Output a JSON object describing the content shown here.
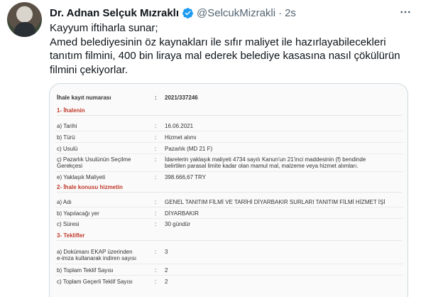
{
  "author": {
    "name": "Dr. Adnan Selçuk Mızraklı",
    "handle": "@SelcukMizrakli",
    "separator": "·",
    "time": "2s"
  },
  "tweet": {
    "lines": [
      "Kayyum iftiharla sunar;",
      "Amed belediyesinin öz kaynakları ile sıfır maliyet ile hazırlayabilecekleri",
      "tanıtım filmini, 400 bin liraya mal ederek belediye kasasına nasıl çökülürün",
      "filmini çekiyorlar."
    ]
  },
  "document": {
    "ihale_kayit": {
      "label": "İhale kayıt numarası",
      "sep": ":",
      "value": "2021/337246"
    },
    "section1": "1- İhalenin",
    "rows1": [
      {
        "label": "a) Tarihi",
        "sep": ":",
        "value": "16.06.2021"
      },
      {
        "label": "b) Türü",
        "sep": ":",
        "value": "Hizmet alımı"
      },
      {
        "label": "c) Usulü",
        "sep": ":",
        "value": "Pazarlık (MD 21 F)"
      },
      {
        "label": "ç) Pazarlık Usulünün Seçilme",
        "label2": "Gerekçesi",
        "sep": ":",
        "value": "İdarelerin yaklaşık maliyeti 4734 sayılı Kanun'un 21'inci maddesinin (f) bendinde",
        "value2": "belirtilen parasal limite kadar olan mamul mal, malzeme veya hizmet alımları."
      },
      {
        "label": "e) Yaklaşık Maliyeti",
        "sep": ":",
        "value": "398.666,67 TRY"
      }
    ],
    "section2": "2- İhale konusu hizmetin",
    "rows2": [
      {
        "label": "a) Adı",
        "sep": ":",
        "value": "GENEL TANITIM FİLMİ VE TARİHİ DİYARBAKIR SURLARI TANITIM FİLMİ HİZMET İŞİ"
      },
      {
        "label": "b) Yapılacağı yer",
        "sep": ":",
        "value": "DİYARBAKIR"
      },
      {
        "label": "c) Süresi",
        "sep": ":",
        "value": "30 gündür"
      }
    ],
    "section3": "3- Teklifler",
    "rows3": [
      {
        "label": "a) Dokümanı EKAP üzerinden",
        "label2": "e-imza kullanarak indiren sayısı",
        "sep": ":",
        "value": "3"
      },
      {
        "label": "b) Toplam Teklif Sayısı",
        "sep": ":",
        "value": "2"
      },
      {
        "label": "c) Toplam Geçerli Teklif Sayısı",
        "sep": ":",
        "value": "2"
      }
    ]
  },
  "colors": {
    "verified": "#1d9bf0",
    "section_heading": "#c0392b",
    "secondary_text": "#536471"
  },
  "icons": {
    "verified": "verified-badge-icon",
    "more": "more-options-icon"
  }
}
